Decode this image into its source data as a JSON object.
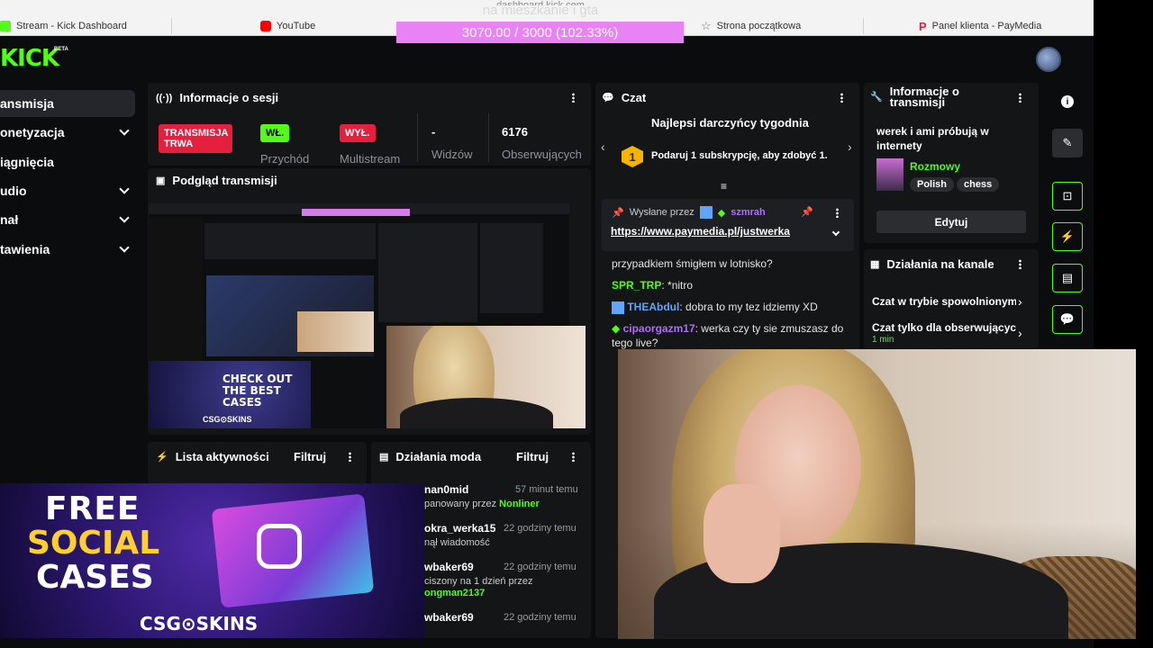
{
  "browser": {
    "url_fragment": "dashboard.kick.com",
    "bookmarks": [
      {
        "label": "Stream - Kick Dashboard",
        "icon_color": "#53fc18"
      },
      {
        "label": "YouTube",
        "icon_color": "#ff0000"
      },
      {
        "label": "Strona początkowa",
        "icon_color": "#777777"
      },
      {
        "label": "Panel klienta - PayMedia",
        "icon_color": "#e5203f"
      }
    ]
  },
  "overlay": {
    "top_text": "na mieszkanie i gta",
    "progress_text": "3070.00 / 3000 (102.33%)",
    "progress_fraction": 1.0233,
    "progress_color": "#e882f5"
  },
  "header": {
    "logo": "KICK",
    "beta": "BETA"
  },
  "sidebar": {
    "items": [
      {
        "label": "ansmisja",
        "active": true,
        "expandable": false
      },
      {
        "label": "onetyzacja",
        "active": false,
        "expandable": true
      },
      {
        "label": "iągnięcia",
        "active": false,
        "expandable": false
      },
      {
        "label": "udio",
        "active": false,
        "expandable": true
      },
      {
        "label": "nał",
        "active": false,
        "expandable": true
      },
      {
        "label": "tawienia",
        "active": false,
        "expandable": true
      }
    ]
  },
  "session": {
    "title": "Informacje o sesji",
    "live_badge": "TRANSMISJA TRWA",
    "revenue_badge": "WŁ.",
    "revenue_label": "Przychód",
    "multistream_badge": "WYŁ.",
    "multistream_label": "Multistream",
    "viewers_value": "-",
    "viewers_label": "Widzów",
    "followers_value": "6176",
    "followers_label": "Obserwujących"
  },
  "preview": {
    "title": "Podgląd transmisji"
  },
  "activity": {
    "title": "Lista aktywności",
    "filter": "Filtruj"
  },
  "mod_actions": {
    "title": "Działania moda",
    "filter": "Filtruj",
    "rows": [
      {
        "name": "nan0mid",
        "time": "57 minut temu",
        "detail_prefix": "panowany przez",
        "detail_name": "Nonliner"
      },
      {
        "name": "okra_werka15",
        "time": "22 godziny temu",
        "detail_prefix": "nął wiadomość",
        "detail_name": ""
      },
      {
        "name": "wbaker69",
        "time": "22 godziny temu",
        "detail_prefix": "ciszony na 1 dzień przez",
        "detail_name": "ongman2137"
      },
      {
        "name": "wbaker69",
        "time": "22 godziny temu",
        "detail_prefix": "",
        "detail_name": ""
      }
    ]
  },
  "chat": {
    "title": "Czat",
    "top_donors": "Najlepsi darczyńcy tygodnia",
    "promo_number": "1",
    "promo_text": "Podaruj 1 subskrypcję, aby zdobyć 1.",
    "pinned_by_label": "Wysłane przez",
    "pinned_user": "szmrah",
    "pinned_link": "https://www.paymedia.pl/justwerka",
    "messages": [
      {
        "user": "",
        "text": "przypadkiem śmigłem w lotnisko?",
        "color": "#ffffff"
      },
      {
        "user": "SPR_TRP",
        "text": ": *nitro",
        "color": "#53fc18"
      },
      {
        "user": "THEAbdul",
        "text": ": dobra to my tez idziemy XD",
        "color": "#60a5fa"
      },
      {
        "user": "cipaorgazm17",
        "text": ": werka czy ty sie zmuszasz do tego live?",
        "color": "#b06bff"
      }
    ]
  },
  "channel_info": {
    "title": "Informacje o transmisji",
    "stream_title": "werek i ami próbują w internety",
    "category": "Rozmowy",
    "tags": [
      "Polish",
      "chess"
    ],
    "edit_button": "Edytuj"
  },
  "channel_actions": {
    "title": "Działania na kanale",
    "items": [
      {
        "label": "Czat w trybie spowolnionym",
        "sub": ""
      },
      {
        "label": "Czat tylko dla obserwujących",
        "sub": "1 min"
      }
    ]
  },
  "ad": {
    "line1": "FREE",
    "line2": "SOCIAL",
    "line3": "CASES",
    "brand": "CSG⊙SKINS",
    "preview_text": "CHECK OUT THE BEST CASES",
    "preview_brand": "CSG⊙SKINS"
  }
}
